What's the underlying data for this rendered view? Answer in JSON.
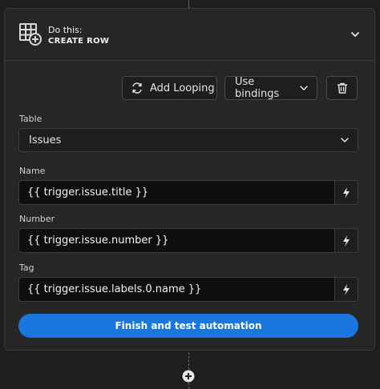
{
  "step": {
    "prefix": "Do this:",
    "name": "CREATE ROW"
  },
  "toolbar": {
    "looping_label": "Add Looping",
    "bindings_label": "Use bindings"
  },
  "fields": {
    "table": {
      "label": "Table",
      "value": "Issues"
    },
    "name": {
      "label": "Name",
      "value": "{{ trigger.issue.title }}"
    },
    "number": {
      "label": "Number",
      "value": "{{ trigger.issue.number }}"
    },
    "tag": {
      "label": "Tag",
      "value": "{{ trigger.issue.labels.0.name }}"
    }
  },
  "actions": {
    "finish_label": "Finish and test automation"
  },
  "icons": {
    "step": "table-add-icon",
    "collapse": "chevron-down-icon",
    "loop": "loop-icon",
    "dropdown": "chevron-down-icon",
    "delete": "trash-icon",
    "binding": "lightning-bolt-icon",
    "add_step": "add-circle-icon"
  },
  "colors": {
    "background": "#1e1e1e",
    "card": "#262626",
    "primary": "#1b77e0",
    "input": "#0f0f0f"
  }
}
